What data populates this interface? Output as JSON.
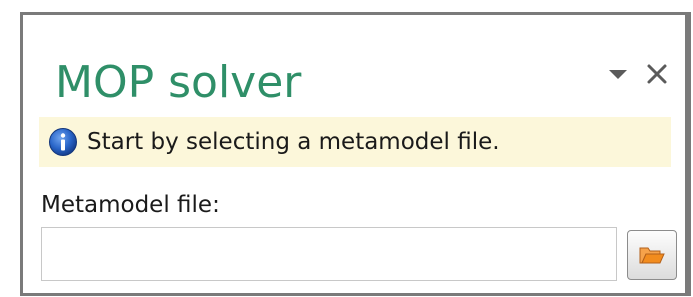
{
  "panel": {
    "title": "MOP solver",
    "menu_icon": "chevron-down-icon",
    "close_icon": "close-icon"
  },
  "info_bar": {
    "icon": "info-icon",
    "message": "Start by selecting a metamodel file."
  },
  "metamodel": {
    "label": "Metamodel file:",
    "value": "",
    "browse_icon": "folder-icon"
  },
  "colors": {
    "title": "#2f8f68",
    "info_background": "#fcf7da",
    "info_icon": "#1e5fbf",
    "folder_icon": "#f28c1e",
    "frame_border": "#7a7a7a"
  }
}
